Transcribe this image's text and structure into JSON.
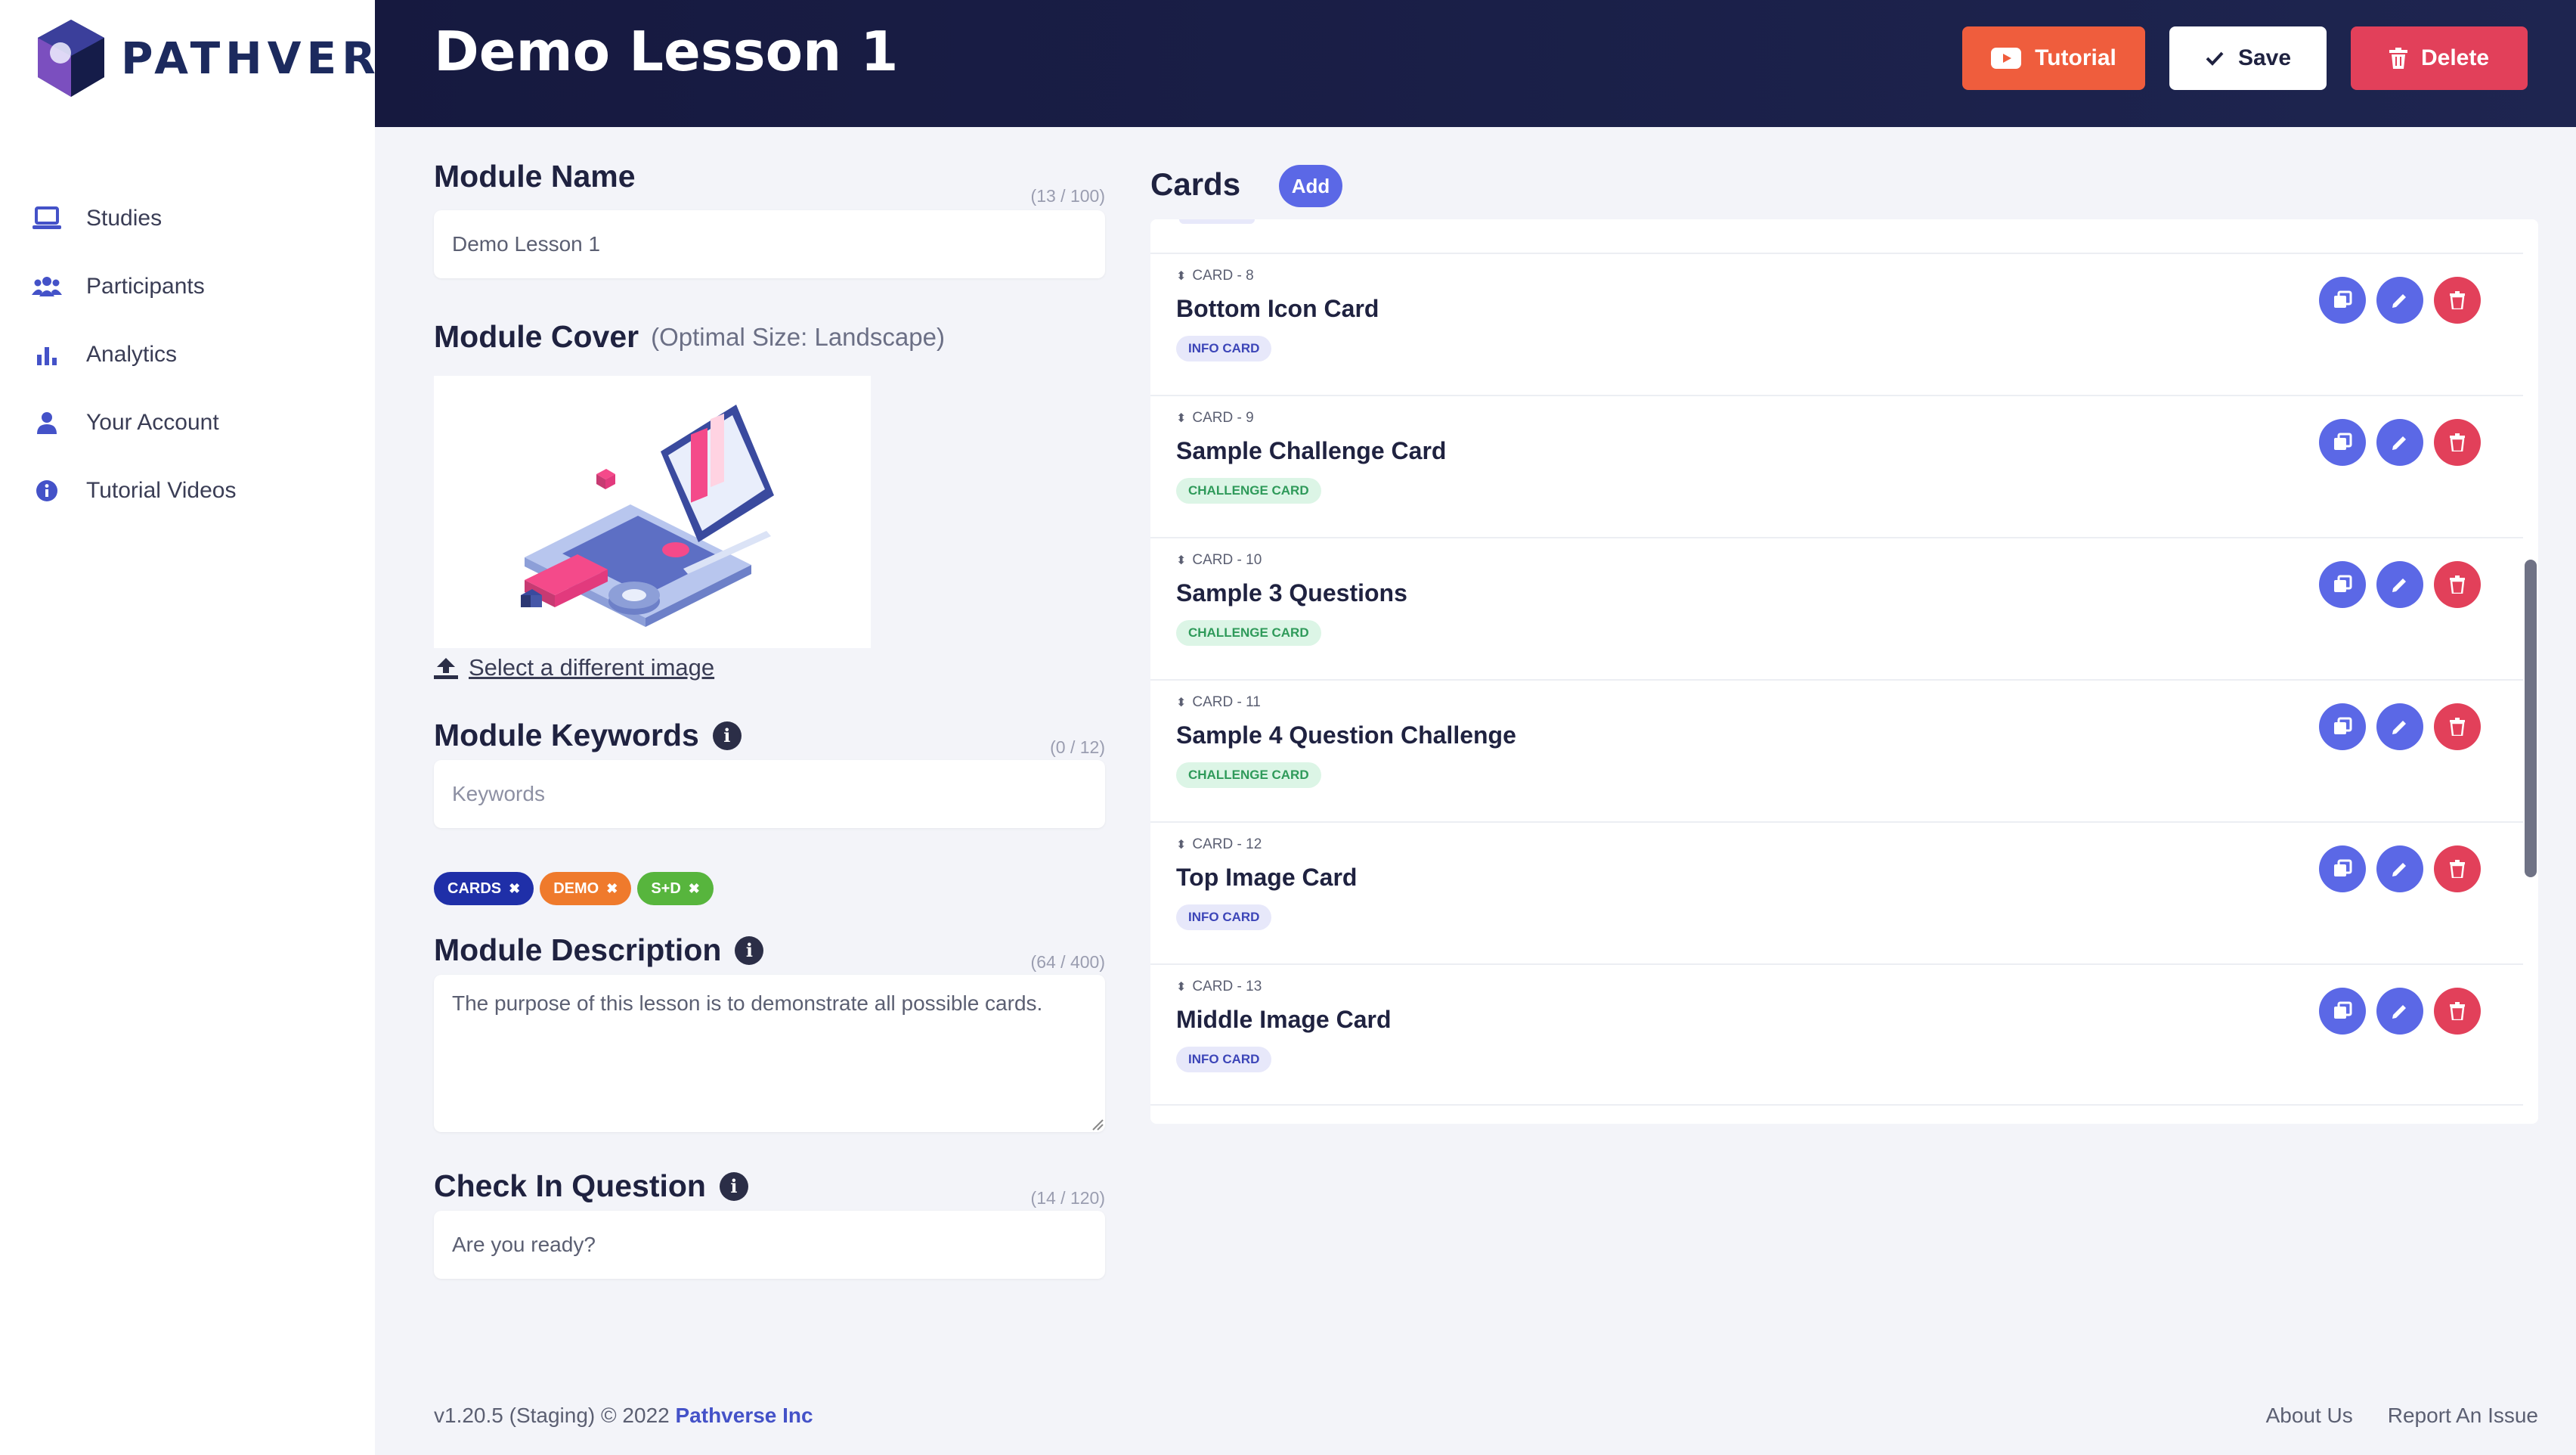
{
  "brand": {
    "name": "PATHVERSE"
  },
  "sidebar": {
    "items": [
      {
        "label": "Studies",
        "icon": "laptop-icon"
      },
      {
        "label": "Participants",
        "icon": "users-icon"
      },
      {
        "label": "Analytics",
        "icon": "bar-chart-icon"
      },
      {
        "label": "Your Account",
        "icon": "user-icon"
      },
      {
        "label": "Tutorial Videos",
        "icon": "info-circle-icon"
      }
    ]
  },
  "header": {
    "title": "Demo Lesson 1",
    "tutorial_label": "Tutorial",
    "save_label": "Save",
    "delete_label": "Delete"
  },
  "form": {
    "module_name": {
      "title": "Module Name",
      "counter": "(13 / 100)",
      "value": "Demo Lesson 1"
    },
    "module_cover": {
      "title": "Module Cover",
      "hint": "(Optimal Size: Landscape)",
      "select_label": "Select a different image"
    },
    "keywords": {
      "title": "Module Keywords",
      "counter": "(0 / 12)",
      "placeholder": "Keywords",
      "tags": [
        {
          "label": "CARDS",
          "color": "#1f2fa8"
        },
        {
          "label": "DEMO",
          "color": "#ef7a2c"
        },
        {
          "label": "S+D",
          "color": "#57b53d"
        }
      ]
    },
    "description": {
      "title": "Module Description",
      "counter": "(64 / 400)",
      "value": "The purpose of this lesson is to demonstrate all possible cards."
    },
    "check_in": {
      "title": "Check In Question",
      "counter": "(14 / 120)",
      "value": "Are you ready?"
    }
  },
  "cards": {
    "title": "Cards",
    "add_label": "Add",
    "items": [
      {
        "number": "CARD - 8",
        "title": "Bottom Icon Card",
        "type": "INFO CARD",
        "kind": "info"
      },
      {
        "number": "CARD - 9",
        "title": "Sample Challenge Card",
        "type": "CHALLENGE CARD",
        "kind": "challenge"
      },
      {
        "number": "CARD - 10",
        "title": "Sample 3 Questions",
        "type": "CHALLENGE CARD",
        "kind": "challenge"
      },
      {
        "number": "CARD - 11",
        "title": "Sample 4 Question Challenge",
        "type": "CHALLENGE CARD",
        "kind": "challenge"
      },
      {
        "number": "CARD - 12",
        "title": "Top Image Card",
        "type": "INFO CARD",
        "kind": "info"
      },
      {
        "number": "CARD - 13",
        "title": "Middle Image Card",
        "type": "INFO CARD",
        "kind": "info"
      }
    ]
  },
  "footer": {
    "version": "v1.20.5 (Staging) © 2022",
    "company": "Pathverse Inc",
    "about": "About Us",
    "report": "Report An Issue"
  },
  "colors": {
    "accent": "#5b68e6",
    "danger": "#e2405a",
    "tutorial": "#ef5d3d",
    "header_bg": "#16193f"
  }
}
